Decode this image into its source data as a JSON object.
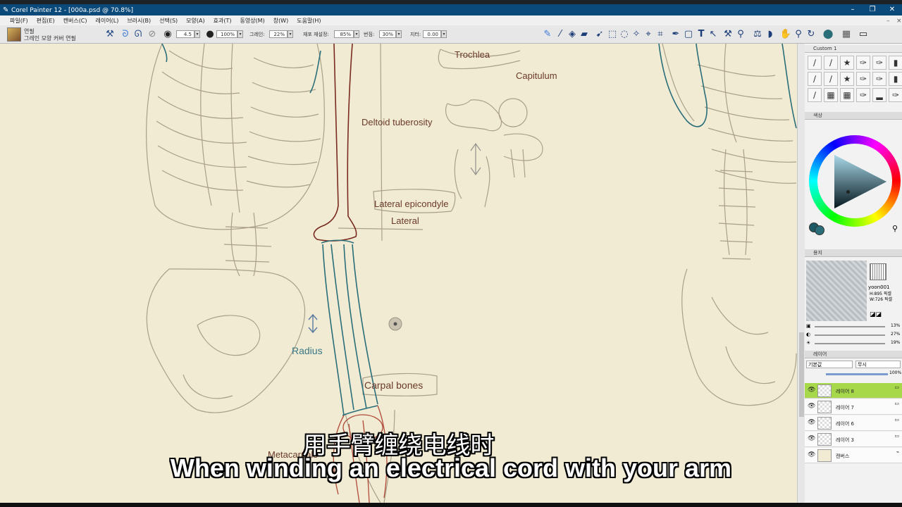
{
  "window": {
    "title": "Corel Painter 12 - [000a.psd @ 70.8%]",
    "app_icon": "painter-brush-icon"
  },
  "menu": [
    "파일(F)",
    "편집(E)",
    "캔버스(C)",
    "레이어(L)",
    "브러시(B)",
    "선택(S)",
    "모양(A)",
    "효과(T)",
    "동영상(M)",
    "창(W)",
    "도움말(H)"
  ],
  "property_bar": {
    "brush_category": "연필",
    "brush_variant": "그레인 모양 커버 연필",
    "size_value": "4.5",
    "opacity_value": "100%",
    "grain_label": "그레인:",
    "grain_value": "22%",
    "resaturation_label": "재포 재설정:",
    "resaturation_value": "85%",
    "bleed_label": "번짐:",
    "bleed_value": "30%",
    "jitter_label": "지터:",
    "jitter_value": "0.00"
  },
  "canvas": {
    "annotations": {
      "trochlea": "Trochlea",
      "capitulum": "Capitulum",
      "deltoid": "Deltoid tuberosity",
      "lateral_epicondyle": "Lateral epicondyle",
      "lateral": "Lateral",
      "radius": "Radius",
      "carpal": "Carpal bones",
      "metacarpals": "Metacarpals"
    },
    "paper_color": "#f0ebd2",
    "line_color": "#6b3a2a",
    "accent_teal": "#2a6e7a"
  },
  "subtitles": {
    "chinese": "用手臂缠绕电线时",
    "english": "When winding an electrical cord with your arm"
  },
  "panels": {
    "brushes": {
      "tab": "Custom 1"
    },
    "color": {
      "header": "색상"
    },
    "paper": {
      "header": "용지",
      "name": "yoon001",
      "height": "H:895 픽셀",
      "width": "W:726 픽셀",
      "slider1": "13%",
      "slider2": "27%",
      "slider3": "19%"
    },
    "layers": {
      "header": "레이어",
      "composite_method": "기본값",
      "composite_depth": "무시",
      "opacity": "100%",
      "items": [
        {
          "name": "레이어 8",
          "selected": true
        },
        {
          "name": "레이어 7",
          "selected": false
        },
        {
          "name": "레이어 6",
          "selected": false
        },
        {
          "name": "레이어 3",
          "selected": false
        },
        {
          "name": "캔버스",
          "selected": false
        }
      ]
    }
  }
}
